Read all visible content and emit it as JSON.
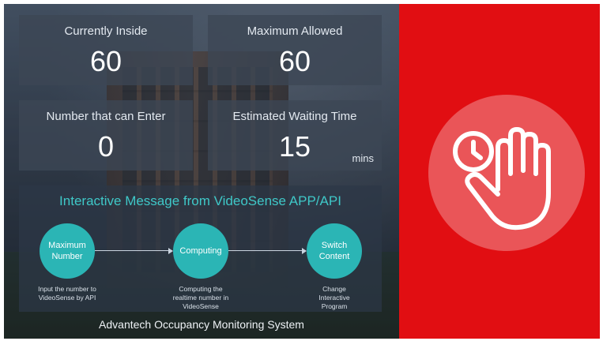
{
  "stats": {
    "currently_inside": {
      "label": "Currently Inside",
      "value": "60"
    },
    "maximum_allowed": {
      "label": "Maximum Allowed",
      "value": "60"
    },
    "can_enter": {
      "label": "Number that can Enter",
      "value": "0"
    },
    "waiting_time": {
      "label": "Estimated Waiting Time",
      "value": "15",
      "unit": "mins"
    }
  },
  "interactive": {
    "title": "Interactive Message from VideoSense APP/API",
    "steps": [
      {
        "circle": "Maximum Number",
        "caption": "Input the number to VideoSense by API"
      },
      {
        "circle": "Computing",
        "caption": "Computing the realtime number in VideoSense"
      },
      {
        "circle": "Switch Content",
        "caption": "Change Interactive Program"
      }
    ]
  },
  "footer": {
    "title": "Advantech Occupancy Monitoring System"
  },
  "alert": {
    "icon": "stop-hand-clock-icon"
  },
  "colors": {
    "accent_teal": "#2bb5b5",
    "title_teal": "#3fc8c8",
    "alert_red": "#e10e12",
    "alert_circle": "#ea5558"
  }
}
